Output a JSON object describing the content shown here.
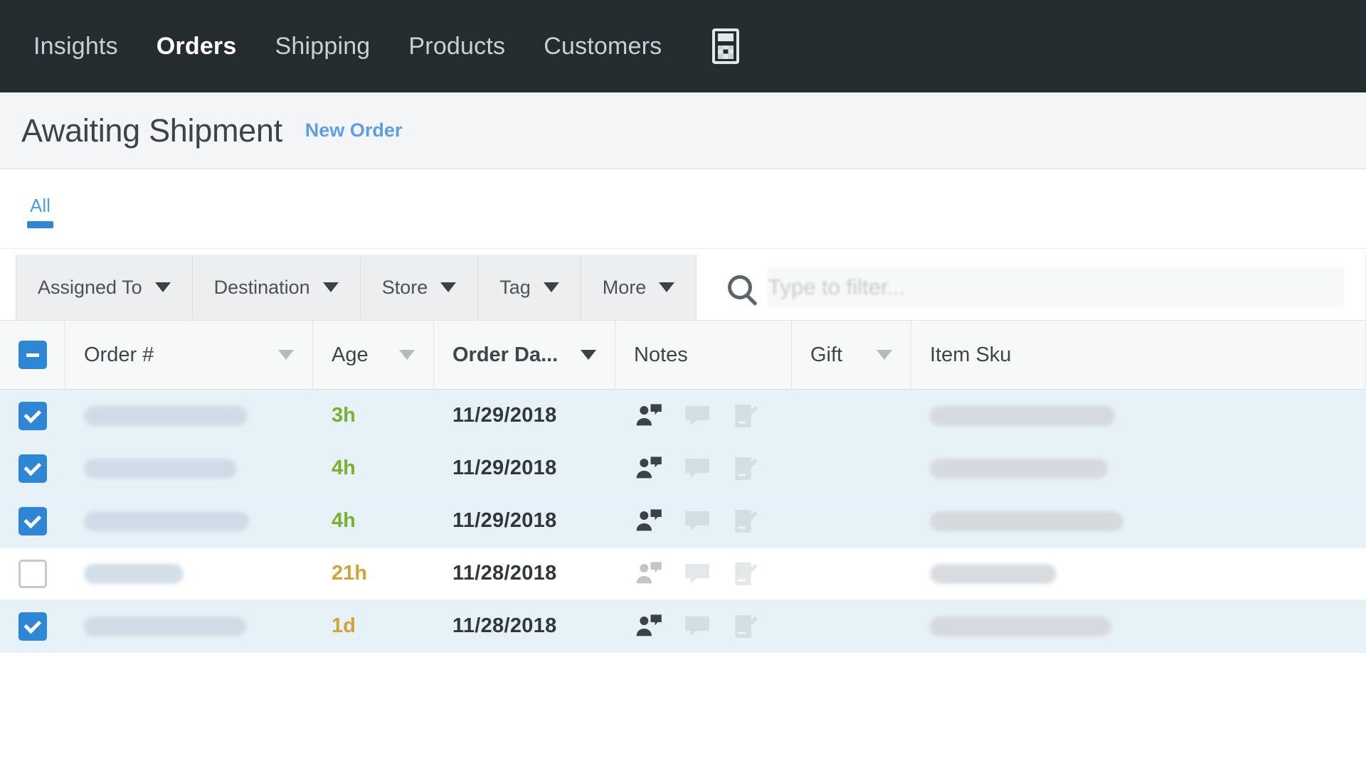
{
  "nav": {
    "items": [
      {
        "label": "Insights",
        "active": false
      },
      {
        "label": "Orders",
        "active": true
      },
      {
        "label": "Shipping",
        "active": false
      },
      {
        "label": "Products",
        "active": false
      },
      {
        "label": "Customers",
        "active": false
      }
    ],
    "icon": "calculator-icon"
  },
  "header": {
    "title": "Awaiting Shipment",
    "new_order_label": "New Order"
  },
  "tabs": [
    {
      "label": "All",
      "active": true
    }
  ],
  "filters": {
    "buttons": [
      {
        "label": "Assigned To"
      },
      {
        "label": "Destination"
      },
      {
        "label": "Store"
      },
      {
        "label": "Tag"
      },
      {
        "label": "More"
      }
    ],
    "search": {
      "placeholder": "Type to filter...",
      "value": "",
      "icon": "search-icon"
    }
  },
  "table": {
    "select_all_state": "indeterminate",
    "columns": [
      {
        "label": "Order #",
        "sortable": true,
        "sorted": false,
        "caret": "light"
      },
      {
        "label": "Age",
        "sortable": true,
        "sorted": false,
        "caret": "light"
      },
      {
        "label": "Order Da...",
        "sortable": true,
        "sorted": true,
        "caret": "dark"
      },
      {
        "label": "Notes",
        "sortable": false,
        "sorted": false,
        "caret": "none"
      },
      {
        "label": "Gift",
        "sortable": true,
        "sorted": false,
        "caret": "light"
      },
      {
        "label": "Item Sku",
        "sortable": false,
        "sorted": false,
        "caret": "none"
      }
    ],
    "rows": [
      {
        "selected": true,
        "order": "",
        "age": "3h",
        "age_color": "green",
        "order_date": "11/29/2018",
        "notes": [
          "customer-note-icon",
          "internal-note-icon",
          "edit-note-icon"
        ],
        "notes_active": [
          true,
          false,
          false
        ],
        "gift": "",
        "item_sku": ""
      },
      {
        "selected": true,
        "order": "",
        "age": "4h",
        "age_color": "green",
        "order_date": "11/29/2018",
        "notes": [
          "customer-note-icon",
          "internal-note-icon",
          "edit-note-icon"
        ],
        "notes_active": [
          true,
          false,
          false
        ],
        "gift": "",
        "item_sku": ""
      },
      {
        "selected": true,
        "order": "",
        "age": "4h",
        "age_color": "green",
        "order_date": "11/29/2018",
        "notes": [
          "customer-note-icon",
          "internal-note-icon",
          "edit-note-icon"
        ],
        "notes_active": [
          true,
          false,
          false
        ],
        "gift": "",
        "item_sku": ""
      },
      {
        "selected": false,
        "order": "",
        "age": "21h",
        "age_color": "amber",
        "order_date": "11/28/2018",
        "notes": [
          "customer-note-icon",
          "internal-note-icon",
          "edit-note-icon"
        ],
        "notes_active": [
          false,
          false,
          false
        ],
        "gift": "",
        "item_sku": ""
      },
      {
        "selected": true,
        "order": "",
        "age": "1d",
        "age_color": "amber",
        "order_date": "11/28/2018",
        "notes": [
          "customer-note-icon",
          "internal-note-icon",
          "edit-note-icon"
        ],
        "notes_active": [
          true,
          false,
          false
        ],
        "gift": "",
        "item_sku": ""
      }
    ]
  },
  "colors": {
    "nav_bg": "#242c30",
    "accent_blue": "#2f86d4",
    "link_blue": "#5d9fe0",
    "age_green": "#79b22e",
    "age_amber": "#cfa43a",
    "row_selected_bg": "#e7f1f8"
  }
}
